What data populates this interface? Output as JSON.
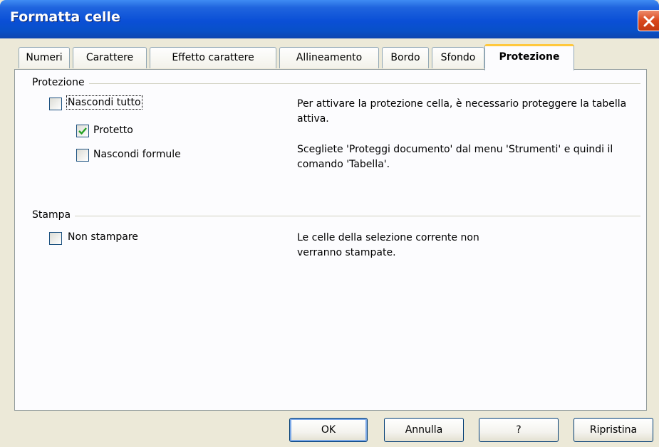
{
  "window": {
    "title": "Formatta celle"
  },
  "tabs": [
    {
      "label": "Numeri"
    },
    {
      "label": "Carattere"
    },
    {
      "label": "Effetto carattere"
    },
    {
      "label": "Allineamento"
    },
    {
      "label": "Bordo"
    },
    {
      "label": "Sfondo"
    },
    {
      "label": "Protezione",
      "active": true
    }
  ],
  "protection": {
    "group_label": "Protezione",
    "hide_all": {
      "label": "Nascondi tutto",
      "checked": false
    },
    "protected": {
      "label": "Protetto",
      "checked": true
    },
    "hide_formulas": {
      "label": "Nascondi formule",
      "checked": false
    },
    "desc1": "Per attivare la protezione cella, è necessario proteggere la tabella attiva.",
    "desc2": "Scegliete 'Proteggi documento' dal menu 'Strumenti' e quindi il comando 'Tabella'."
  },
  "print": {
    "group_label": "Stampa",
    "no_print": {
      "label": "Non stampare",
      "checked": false
    },
    "desc": "Le celle della selezione corrente non verranno stampate."
  },
  "buttons": {
    "ok": "OK",
    "cancel": "Annulla",
    "help": "?",
    "reset": "Ripristina"
  },
  "colors": {
    "titlebar": "#0a4fd6",
    "dialog_bg": "#ece9d8",
    "active_tab_accent": "#ffc83c",
    "close_button": "#d9481d",
    "checkmark": "#21a121"
  }
}
